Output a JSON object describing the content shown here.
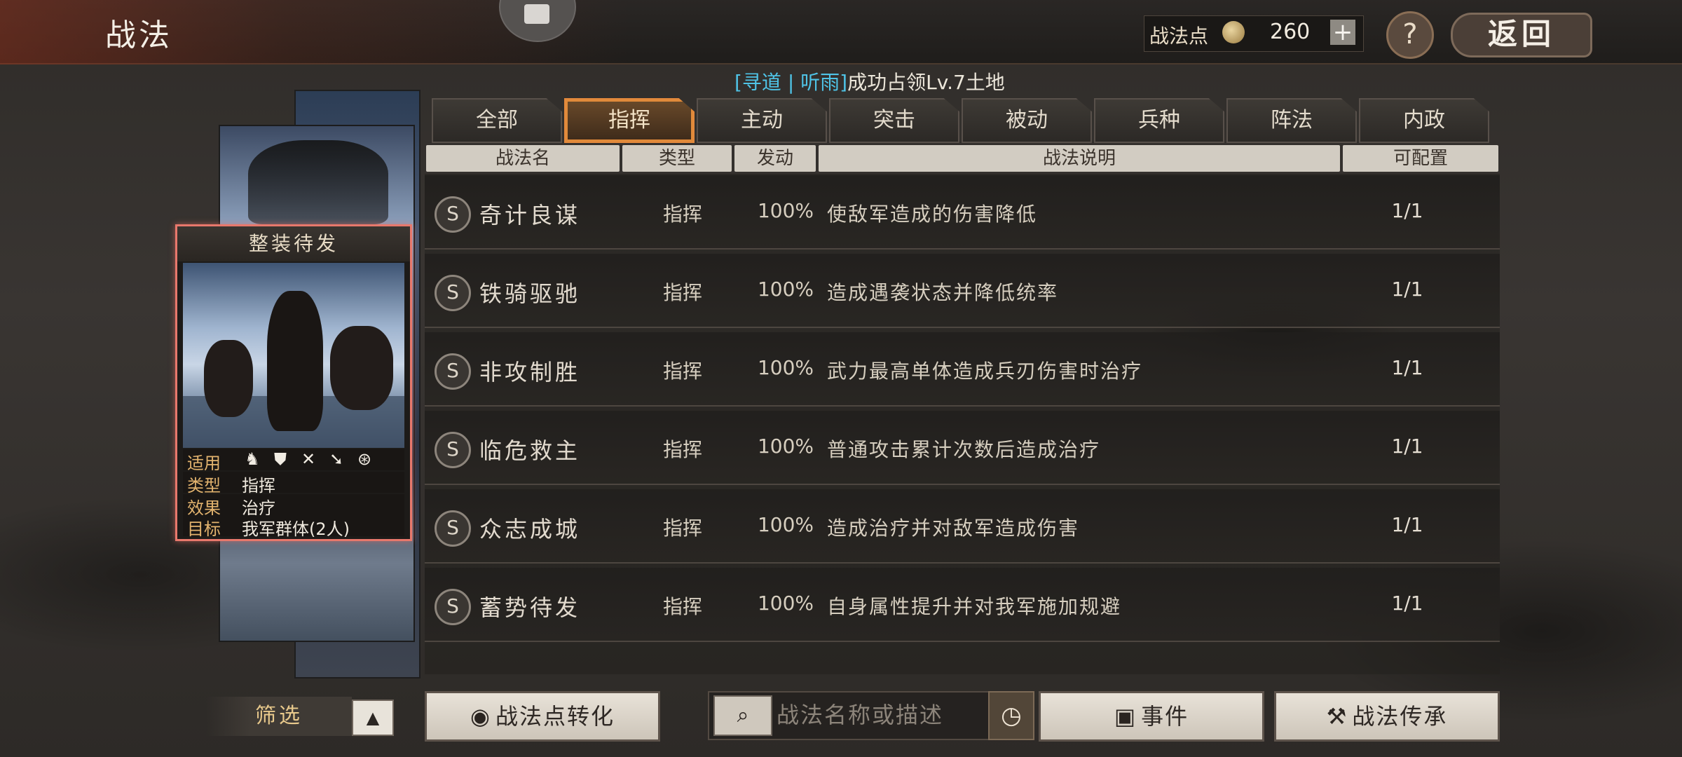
{
  "header": {
    "title": "战法",
    "points_label": "战法点",
    "points_value": "260",
    "plus_label": "+",
    "help_label": "?",
    "back_label": "返回"
  },
  "notice": {
    "prefix": "[寻道 | 听雨]",
    "text": "成功占领Lv.7土地"
  },
  "card": {
    "title": "整装待发",
    "applies_label": "适用",
    "applies_icons": [
      "cavalry-icon",
      "shield-icon",
      "crossed-bow-icon",
      "spear-icon",
      "wheel-icon"
    ],
    "type_label": "类型",
    "type_value": "指挥",
    "effect_label": "效果",
    "effect_value": "治疗",
    "target_label": "目标",
    "target_value": "我军群体(2人)"
  },
  "tabs": [
    {
      "label": "全部",
      "active": false
    },
    {
      "label": "指挥",
      "active": true
    },
    {
      "label": "主动",
      "active": false
    },
    {
      "label": "突击",
      "active": false
    },
    {
      "label": "被动",
      "active": false
    },
    {
      "label": "兵种",
      "active": false
    },
    {
      "label": "阵法",
      "active": false
    },
    {
      "label": "内政",
      "active": false
    }
  ],
  "table": {
    "headers": [
      "战法名",
      "类型",
      "发动",
      "战法说明",
      "可配置"
    ],
    "rows": [
      {
        "grade": "S",
        "name": "奇计良谋",
        "type": "指挥",
        "rate": "100%",
        "desc": "使敌军造成的伤害降低",
        "cfg": "1/1"
      },
      {
        "grade": "S",
        "name": "铁骑驱驰",
        "type": "指挥",
        "rate": "100%",
        "desc": "造成遇袭状态并降低统率",
        "cfg": "1/1"
      },
      {
        "grade": "S",
        "name": "非攻制胜",
        "type": "指挥",
        "rate": "100%",
        "desc": "武力最高单体造成兵刃伤害时治疗",
        "cfg": "1/1"
      },
      {
        "grade": "S",
        "name": "临危救主",
        "type": "指挥",
        "rate": "100%",
        "desc": "普通攻击累计次数后造成治疗",
        "cfg": "1/1"
      },
      {
        "grade": "S",
        "name": "众志成城",
        "type": "指挥",
        "rate": "100%",
        "desc": "造成治疗并对敌军造成伤害",
        "cfg": "1/1"
      },
      {
        "grade": "S",
        "name": "蓄势待发",
        "type": "指挥",
        "rate": "100%",
        "desc": "自身属性提升并对我军施加规避",
        "cfg": "1/1"
      }
    ]
  },
  "bottom": {
    "filter_label": "筛选",
    "filter_toggle": "▲",
    "convert_label": "战法点转化",
    "search_placeholder": "战法名称或描述",
    "event_label": "事件",
    "inherit_label": "战法传承"
  },
  "colors": {
    "accent_orange": "#e08a3a",
    "notice_cyan": "#4fc3e6",
    "card_border": "#e8786c"
  }
}
